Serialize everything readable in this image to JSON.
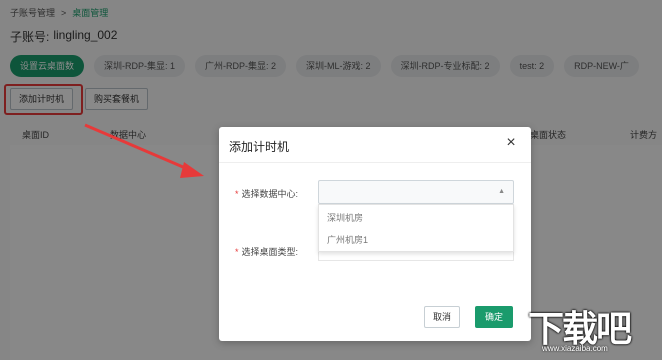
{
  "breadcrumb": {
    "parent": "子账号管理",
    "sep": ">",
    "current": "桌面管理"
  },
  "account": {
    "label": "子账号:",
    "value": "lingling_002"
  },
  "tags": {
    "primary": "设置云桌面数",
    "items": [
      "深圳-RDP-集显: 1",
      "广州-RDP-集显: 2",
      "深圳-ML-游戏: 2",
      "深圳-RDP-专业标配: 2",
      "test: 2",
      "RDP-NEW-广"
    ]
  },
  "actions": {
    "add_timer": "添加计时机",
    "buy_package": "购买套餐机"
  },
  "table": {
    "headers": [
      "桌面ID",
      "数据中心",
      "桌面状态",
      "计费方"
    ]
  },
  "dialog": {
    "title": "添加计时机",
    "close": "×",
    "required_mark": "*",
    "field1_label": "选择数据中心:",
    "field2_label": "选择桌面类型:",
    "select_caret": "▲",
    "dropdown_options": [
      "深圳机房",
      "广州机房1"
    ],
    "cancel": "取消",
    "confirm": "确定"
  },
  "watermark": {
    "text": "下载吧",
    "url": "www.xiazaiba.com"
  },
  "colors": {
    "brand_green": "#1a9b6c",
    "highlight_red": "#e63a3a"
  }
}
